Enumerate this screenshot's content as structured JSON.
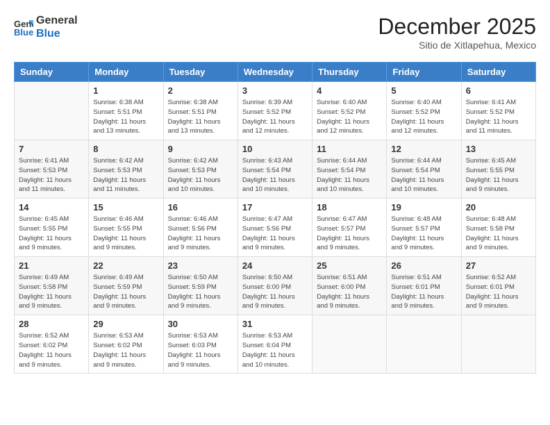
{
  "header": {
    "logo_line1": "General",
    "logo_line2": "Blue",
    "month_title": "December 2025",
    "location": "Sitio de Xitlapehua, Mexico"
  },
  "weekdays": [
    "Sunday",
    "Monday",
    "Tuesday",
    "Wednesday",
    "Thursday",
    "Friday",
    "Saturday"
  ],
  "weeks": [
    [
      {
        "day": "",
        "info": ""
      },
      {
        "day": "1",
        "info": "Sunrise: 6:38 AM\nSunset: 5:51 PM\nDaylight: 11 hours\nand 13 minutes."
      },
      {
        "day": "2",
        "info": "Sunrise: 6:38 AM\nSunset: 5:51 PM\nDaylight: 11 hours\nand 13 minutes."
      },
      {
        "day": "3",
        "info": "Sunrise: 6:39 AM\nSunset: 5:52 PM\nDaylight: 11 hours\nand 12 minutes."
      },
      {
        "day": "4",
        "info": "Sunrise: 6:40 AM\nSunset: 5:52 PM\nDaylight: 11 hours\nand 12 minutes."
      },
      {
        "day": "5",
        "info": "Sunrise: 6:40 AM\nSunset: 5:52 PM\nDaylight: 11 hours\nand 12 minutes."
      },
      {
        "day": "6",
        "info": "Sunrise: 6:41 AM\nSunset: 5:52 PM\nDaylight: 11 hours\nand 11 minutes."
      }
    ],
    [
      {
        "day": "7",
        "info": "Sunrise: 6:41 AM\nSunset: 5:53 PM\nDaylight: 11 hours\nand 11 minutes."
      },
      {
        "day": "8",
        "info": "Sunrise: 6:42 AM\nSunset: 5:53 PM\nDaylight: 11 hours\nand 11 minutes."
      },
      {
        "day": "9",
        "info": "Sunrise: 6:42 AM\nSunset: 5:53 PM\nDaylight: 11 hours\nand 10 minutes."
      },
      {
        "day": "10",
        "info": "Sunrise: 6:43 AM\nSunset: 5:54 PM\nDaylight: 11 hours\nand 10 minutes."
      },
      {
        "day": "11",
        "info": "Sunrise: 6:44 AM\nSunset: 5:54 PM\nDaylight: 11 hours\nand 10 minutes."
      },
      {
        "day": "12",
        "info": "Sunrise: 6:44 AM\nSunset: 5:54 PM\nDaylight: 11 hours\nand 10 minutes."
      },
      {
        "day": "13",
        "info": "Sunrise: 6:45 AM\nSunset: 5:55 PM\nDaylight: 11 hours\nand 9 minutes."
      }
    ],
    [
      {
        "day": "14",
        "info": "Sunrise: 6:45 AM\nSunset: 5:55 PM\nDaylight: 11 hours\nand 9 minutes."
      },
      {
        "day": "15",
        "info": "Sunrise: 6:46 AM\nSunset: 5:55 PM\nDaylight: 11 hours\nand 9 minutes."
      },
      {
        "day": "16",
        "info": "Sunrise: 6:46 AM\nSunset: 5:56 PM\nDaylight: 11 hours\nand 9 minutes."
      },
      {
        "day": "17",
        "info": "Sunrise: 6:47 AM\nSunset: 5:56 PM\nDaylight: 11 hours\nand 9 minutes."
      },
      {
        "day": "18",
        "info": "Sunrise: 6:47 AM\nSunset: 5:57 PM\nDaylight: 11 hours\nand 9 minutes."
      },
      {
        "day": "19",
        "info": "Sunrise: 6:48 AM\nSunset: 5:57 PM\nDaylight: 11 hours\nand 9 minutes."
      },
      {
        "day": "20",
        "info": "Sunrise: 6:48 AM\nSunset: 5:58 PM\nDaylight: 11 hours\nand 9 minutes."
      }
    ],
    [
      {
        "day": "21",
        "info": "Sunrise: 6:49 AM\nSunset: 5:58 PM\nDaylight: 11 hours\nand 9 minutes."
      },
      {
        "day": "22",
        "info": "Sunrise: 6:49 AM\nSunset: 5:59 PM\nDaylight: 11 hours\nand 9 minutes."
      },
      {
        "day": "23",
        "info": "Sunrise: 6:50 AM\nSunset: 5:59 PM\nDaylight: 11 hours\nand 9 minutes."
      },
      {
        "day": "24",
        "info": "Sunrise: 6:50 AM\nSunset: 6:00 PM\nDaylight: 11 hours\nand 9 minutes."
      },
      {
        "day": "25",
        "info": "Sunrise: 6:51 AM\nSunset: 6:00 PM\nDaylight: 11 hours\nand 9 minutes."
      },
      {
        "day": "26",
        "info": "Sunrise: 6:51 AM\nSunset: 6:01 PM\nDaylight: 11 hours\nand 9 minutes."
      },
      {
        "day": "27",
        "info": "Sunrise: 6:52 AM\nSunset: 6:01 PM\nDaylight: 11 hours\nand 9 minutes."
      }
    ],
    [
      {
        "day": "28",
        "info": "Sunrise: 6:52 AM\nSunset: 6:02 PM\nDaylight: 11 hours\nand 9 minutes."
      },
      {
        "day": "29",
        "info": "Sunrise: 6:53 AM\nSunset: 6:02 PM\nDaylight: 11 hours\nand 9 minutes."
      },
      {
        "day": "30",
        "info": "Sunrise: 6:53 AM\nSunset: 6:03 PM\nDaylight: 11 hours\nand 9 minutes."
      },
      {
        "day": "31",
        "info": "Sunrise: 6:53 AM\nSunset: 6:04 PM\nDaylight: 11 hours\nand 10 minutes."
      },
      {
        "day": "",
        "info": ""
      },
      {
        "day": "",
        "info": ""
      },
      {
        "day": "",
        "info": ""
      }
    ]
  ]
}
